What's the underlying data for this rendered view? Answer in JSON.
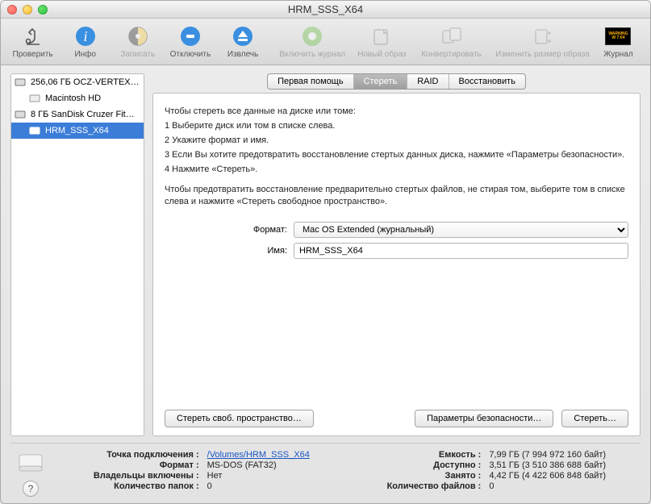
{
  "window": {
    "title": "HRM_SSS_X64"
  },
  "toolbar": {
    "verify": "Проверить",
    "info": "Инфо",
    "burn": "Записать",
    "unmount": "Отключить",
    "eject": "Извлечь",
    "enable_journal": "Включить журнал",
    "new_image": "Новый образ",
    "convert": "Конвертировать",
    "resize_image": "Изменить размер образа",
    "journal": "Журнал"
  },
  "sidebar": {
    "items": [
      {
        "label": "256,06 ГБ OCZ-VERTEX…",
        "kind": "disk"
      },
      {
        "label": "Macintosh HD",
        "kind": "vol",
        "child": true
      },
      {
        "label": "8 ГБ SanDisk Cruzer Fit…",
        "kind": "disk"
      },
      {
        "label": "HRM_SSS_X64",
        "kind": "vol",
        "child": true,
        "selected": true
      }
    ]
  },
  "tabs": {
    "firstaid": "Первая помощь",
    "erase": "Стереть",
    "raid": "RAID",
    "restore": "Восстановить"
  },
  "panel": {
    "intro": "Чтобы стереть все данные на диске или томе:",
    "s1": "1      Выберите диск или том в списке слева.",
    "s2": "2      Укажите формат и имя.",
    "s3": "3      Если Вы хотите предотвратить восстановление стертых данных диска, нажмите «Параметры безопасности».",
    "s4": "4      Нажмите «Стереть».",
    "note": "Чтобы предотвратить восстановление предварительно стертых файлов, не стирая том, выберите том в списке слева и нажмите «Стереть свободное пространство».",
    "format_label": "Формат:",
    "format_value": "Mac OS Extended (журнальный)",
    "name_label": "Имя:",
    "name_value": "HRM_SSS_X64",
    "btn_free": "Стереть своб. пространство…",
    "btn_sec": "Параметры безопасности…",
    "btn_erase": "Стереть…"
  },
  "footer": {
    "mount_k": "Точка подключения :",
    "mount_v": "/Volumes/HRM_SSS_X64",
    "format_k": "Формат :",
    "format_v": "MS-DOS (FAT32)",
    "owners_k": "Владельцы включены :",
    "owners_v": "Нет",
    "folders_k": "Количество папок :",
    "folders_v": "0",
    "capacity_k": "Емкость :",
    "capacity_v": "7,99 ГБ (7 994 972 160 байт)",
    "avail_k": "Доступно :",
    "avail_v": "3,51 ГБ (3 510 386 688 байт)",
    "used_k": "Занято :",
    "used_v": "4,42 ГБ (4 422 606 848 байт)",
    "files_k": "Количество файлов :",
    "files_v": "0",
    "help": "?"
  }
}
